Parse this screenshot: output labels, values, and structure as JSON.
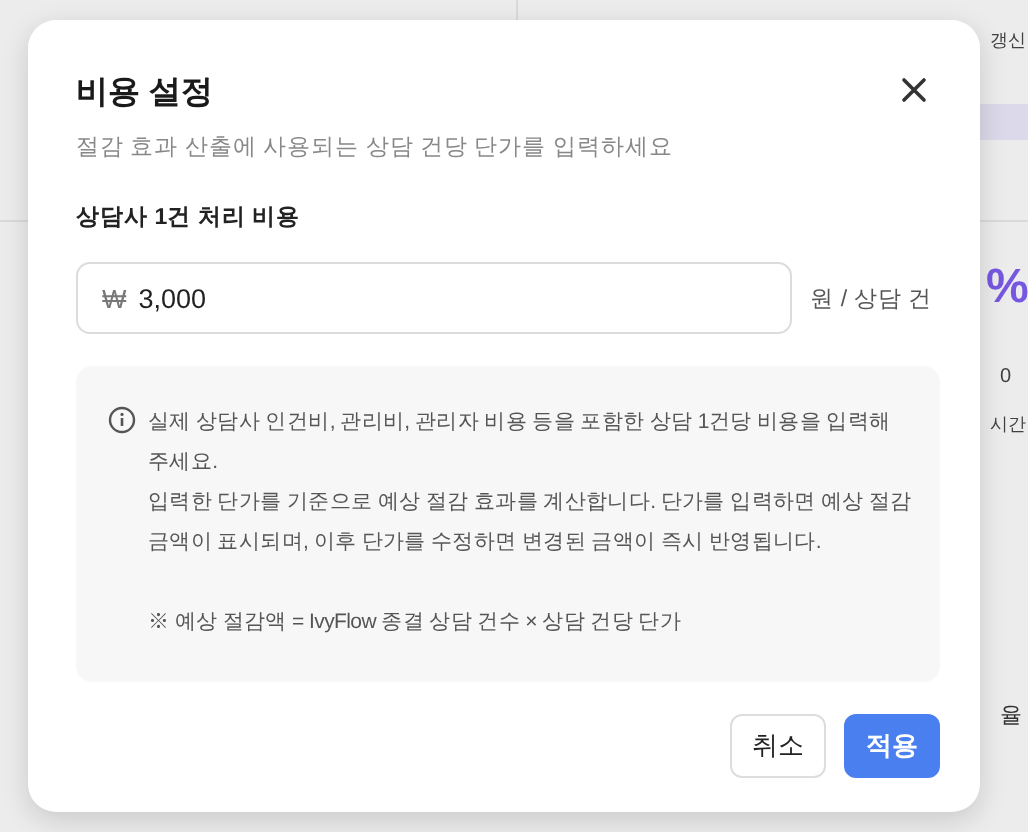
{
  "background": {
    "texts": [
      {
        "text": "갱신",
        "kind": "small"
      },
      {
        "text": "%",
        "kind": "big"
      },
      {
        "text": "0",
        "kind": "count"
      },
      {
        "text": "시간",
        "kind": "small"
      },
      {
        "text": "율",
        "kind": "label"
      }
    ]
  },
  "dialog": {
    "title": "비용 설정",
    "subtitle": "절감 효과 산출에 사용되는 상담 건당 단가를 입력하세요",
    "field": {
      "label": "상담사 1건 처리 비용",
      "prefix": "₩",
      "value": "3,000",
      "unit": "원 / 상담 건"
    },
    "info": {
      "paragraphs": [
        "실제 상담사 인건비, 관리비, 관리자 비용 등을 포함한 상담 1건당 비용을 입력해 주세요.",
        "입력한 단가를 기준으로 예상 절감 효과를 계산합니다. 단가를 입력하면 예상 절감 금액이 표시되며, 이후 단가를 수정하면 변경된 금액이 즉시 반영됩니다."
      ],
      "formula": "※ 예상 절감액 = IvyFlow 종결 상담 건수 × 상담 건당 단가"
    },
    "buttons": [
      {
        "label": "취소",
        "kind": "secondary"
      },
      {
        "label": "적용",
        "kind": "primary"
      }
    ]
  }
}
